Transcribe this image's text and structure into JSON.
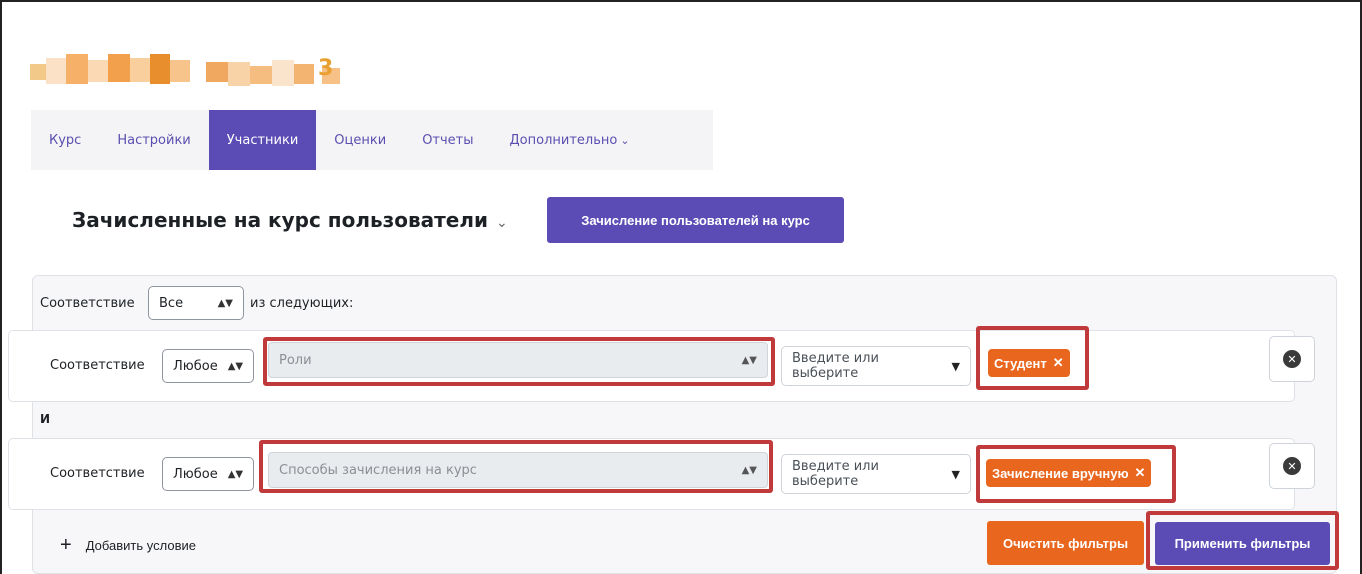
{
  "course": {
    "title_visible": "3"
  },
  "tabs": [
    {
      "label": "Курс"
    },
    {
      "label": "Настройки"
    },
    {
      "label": "Участники"
    },
    {
      "label": "Оценки"
    },
    {
      "label": "Отчеты"
    },
    {
      "label": "Дополнительно"
    }
  ],
  "header": {
    "title": "Зачисленные на курс пользователи",
    "enrol_button": "Зачисление пользователей на курс"
  },
  "filter": {
    "match_label": "Соответствие",
    "match_value": "Все",
    "of_following": "из следующих:",
    "and_label": "И",
    "rows": [
      {
        "match_label": "Соответствие",
        "match_value": "Любое",
        "type": "Роли",
        "input_placeholder": "Введите или выберите",
        "badge": "Студент"
      },
      {
        "match_label": "Соответствие",
        "match_value": "Любое",
        "type": "Способы зачисления на курс",
        "input_placeholder": "Введите или выберите",
        "badge": "Зачисление вручную"
      }
    ],
    "add_condition": "Добавить условие",
    "clear_button": "Очистить фильтры",
    "apply_button": "Применить фильтры"
  },
  "colors": {
    "accent": "#5b4bb5",
    "orange": "#e8661e",
    "highlight": "#c0393b"
  }
}
